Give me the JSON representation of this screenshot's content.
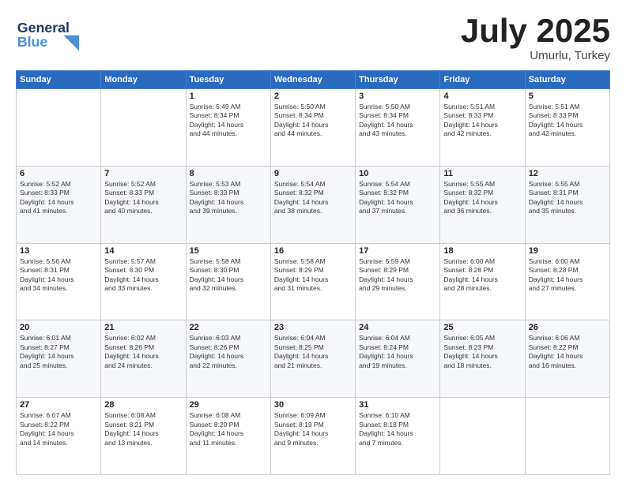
{
  "header": {
    "logo_line1": "General",
    "logo_line2": "Blue",
    "title": "July 2025",
    "location": "Umurlu, Turkey"
  },
  "weekdays": [
    "Sunday",
    "Monday",
    "Tuesday",
    "Wednesday",
    "Thursday",
    "Friday",
    "Saturday"
  ],
  "weeks": [
    [
      {
        "day": "",
        "lines": []
      },
      {
        "day": "",
        "lines": []
      },
      {
        "day": "1",
        "lines": [
          "Sunrise: 5:49 AM",
          "Sunset: 8:34 PM",
          "Daylight: 14 hours",
          "and 44 minutes."
        ]
      },
      {
        "day": "2",
        "lines": [
          "Sunrise: 5:50 AM",
          "Sunset: 8:34 PM",
          "Daylight: 14 hours",
          "and 44 minutes."
        ]
      },
      {
        "day": "3",
        "lines": [
          "Sunrise: 5:50 AM",
          "Sunset: 8:34 PM",
          "Daylight: 14 hours",
          "and 43 minutes."
        ]
      },
      {
        "day": "4",
        "lines": [
          "Sunrise: 5:51 AM",
          "Sunset: 8:33 PM",
          "Daylight: 14 hours",
          "and 42 minutes."
        ]
      },
      {
        "day": "5",
        "lines": [
          "Sunrise: 5:51 AM",
          "Sunset: 8:33 PM",
          "Daylight: 14 hours",
          "and 42 minutes."
        ]
      }
    ],
    [
      {
        "day": "6",
        "lines": [
          "Sunrise: 5:52 AM",
          "Sunset: 8:33 PM",
          "Daylight: 14 hours",
          "and 41 minutes."
        ]
      },
      {
        "day": "7",
        "lines": [
          "Sunrise: 5:52 AM",
          "Sunset: 8:33 PM",
          "Daylight: 14 hours",
          "and 40 minutes."
        ]
      },
      {
        "day": "8",
        "lines": [
          "Sunrise: 5:53 AM",
          "Sunset: 8:33 PM",
          "Daylight: 14 hours",
          "and 39 minutes."
        ]
      },
      {
        "day": "9",
        "lines": [
          "Sunrise: 5:54 AM",
          "Sunset: 8:32 PM",
          "Daylight: 14 hours",
          "and 38 minutes."
        ]
      },
      {
        "day": "10",
        "lines": [
          "Sunrise: 5:54 AM",
          "Sunset: 8:32 PM",
          "Daylight: 14 hours",
          "and 37 minutes."
        ]
      },
      {
        "day": "11",
        "lines": [
          "Sunrise: 5:55 AM",
          "Sunset: 8:32 PM",
          "Daylight: 14 hours",
          "and 36 minutes."
        ]
      },
      {
        "day": "12",
        "lines": [
          "Sunrise: 5:55 AM",
          "Sunset: 8:31 PM",
          "Daylight: 14 hours",
          "and 35 minutes."
        ]
      }
    ],
    [
      {
        "day": "13",
        "lines": [
          "Sunrise: 5:56 AM",
          "Sunset: 8:31 PM",
          "Daylight: 14 hours",
          "and 34 minutes."
        ]
      },
      {
        "day": "14",
        "lines": [
          "Sunrise: 5:57 AM",
          "Sunset: 8:30 PM",
          "Daylight: 14 hours",
          "and 33 minutes."
        ]
      },
      {
        "day": "15",
        "lines": [
          "Sunrise: 5:58 AM",
          "Sunset: 8:30 PM",
          "Daylight: 14 hours",
          "and 32 minutes."
        ]
      },
      {
        "day": "16",
        "lines": [
          "Sunrise: 5:58 AM",
          "Sunset: 8:29 PM",
          "Daylight: 14 hours",
          "and 31 minutes."
        ]
      },
      {
        "day": "17",
        "lines": [
          "Sunrise: 5:59 AM",
          "Sunset: 8:29 PM",
          "Daylight: 14 hours",
          "and 29 minutes."
        ]
      },
      {
        "day": "18",
        "lines": [
          "Sunrise: 6:00 AM",
          "Sunset: 8:28 PM",
          "Daylight: 14 hours",
          "and 28 minutes."
        ]
      },
      {
        "day": "19",
        "lines": [
          "Sunrise: 6:00 AM",
          "Sunset: 8:28 PM",
          "Daylight: 14 hours",
          "and 27 minutes."
        ]
      }
    ],
    [
      {
        "day": "20",
        "lines": [
          "Sunrise: 6:01 AM",
          "Sunset: 8:27 PM",
          "Daylight: 14 hours",
          "and 25 minutes."
        ]
      },
      {
        "day": "21",
        "lines": [
          "Sunrise: 6:02 AM",
          "Sunset: 8:26 PM",
          "Daylight: 14 hours",
          "and 24 minutes."
        ]
      },
      {
        "day": "22",
        "lines": [
          "Sunrise: 6:03 AM",
          "Sunset: 8:26 PM",
          "Daylight: 14 hours",
          "and 22 minutes."
        ]
      },
      {
        "day": "23",
        "lines": [
          "Sunrise: 6:04 AM",
          "Sunset: 8:25 PM",
          "Daylight: 14 hours",
          "and 21 minutes."
        ]
      },
      {
        "day": "24",
        "lines": [
          "Sunrise: 6:04 AM",
          "Sunset: 8:24 PM",
          "Daylight: 14 hours",
          "and 19 minutes."
        ]
      },
      {
        "day": "25",
        "lines": [
          "Sunrise: 6:05 AM",
          "Sunset: 8:23 PM",
          "Daylight: 14 hours",
          "and 18 minutes."
        ]
      },
      {
        "day": "26",
        "lines": [
          "Sunrise: 6:06 AM",
          "Sunset: 8:22 PM",
          "Daylight: 14 hours",
          "and 16 minutes."
        ]
      }
    ],
    [
      {
        "day": "27",
        "lines": [
          "Sunrise: 6:07 AM",
          "Sunset: 8:22 PM",
          "Daylight: 14 hours",
          "and 14 minutes."
        ]
      },
      {
        "day": "28",
        "lines": [
          "Sunrise: 6:08 AM",
          "Sunset: 8:21 PM",
          "Daylight: 14 hours",
          "and 13 minutes."
        ]
      },
      {
        "day": "29",
        "lines": [
          "Sunrise: 6:08 AM",
          "Sunset: 8:20 PM",
          "Daylight: 14 hours",
          "and 11 minutes."
        ]
      },
      {
        "day": "30",
        "lines": [
          "Sunrise: 6:09 AM",
          "Sunset: 8:19 PM",
          "Daylight: 14 hours",
          "and 9 minutes."
        ]
      },
      {
        "day": "31",
        "lines": [
          "Sunrise: 6:10 AM",
          "Sunset: 8:18 PM",
          "Daylight: 14 hours",
          "and 7 minutes."
        ]
      },
      {
        "day": "",
        "lines": []
      },
      {
        "day": "",
        "lines": []
      }
    ]
  ]
}
